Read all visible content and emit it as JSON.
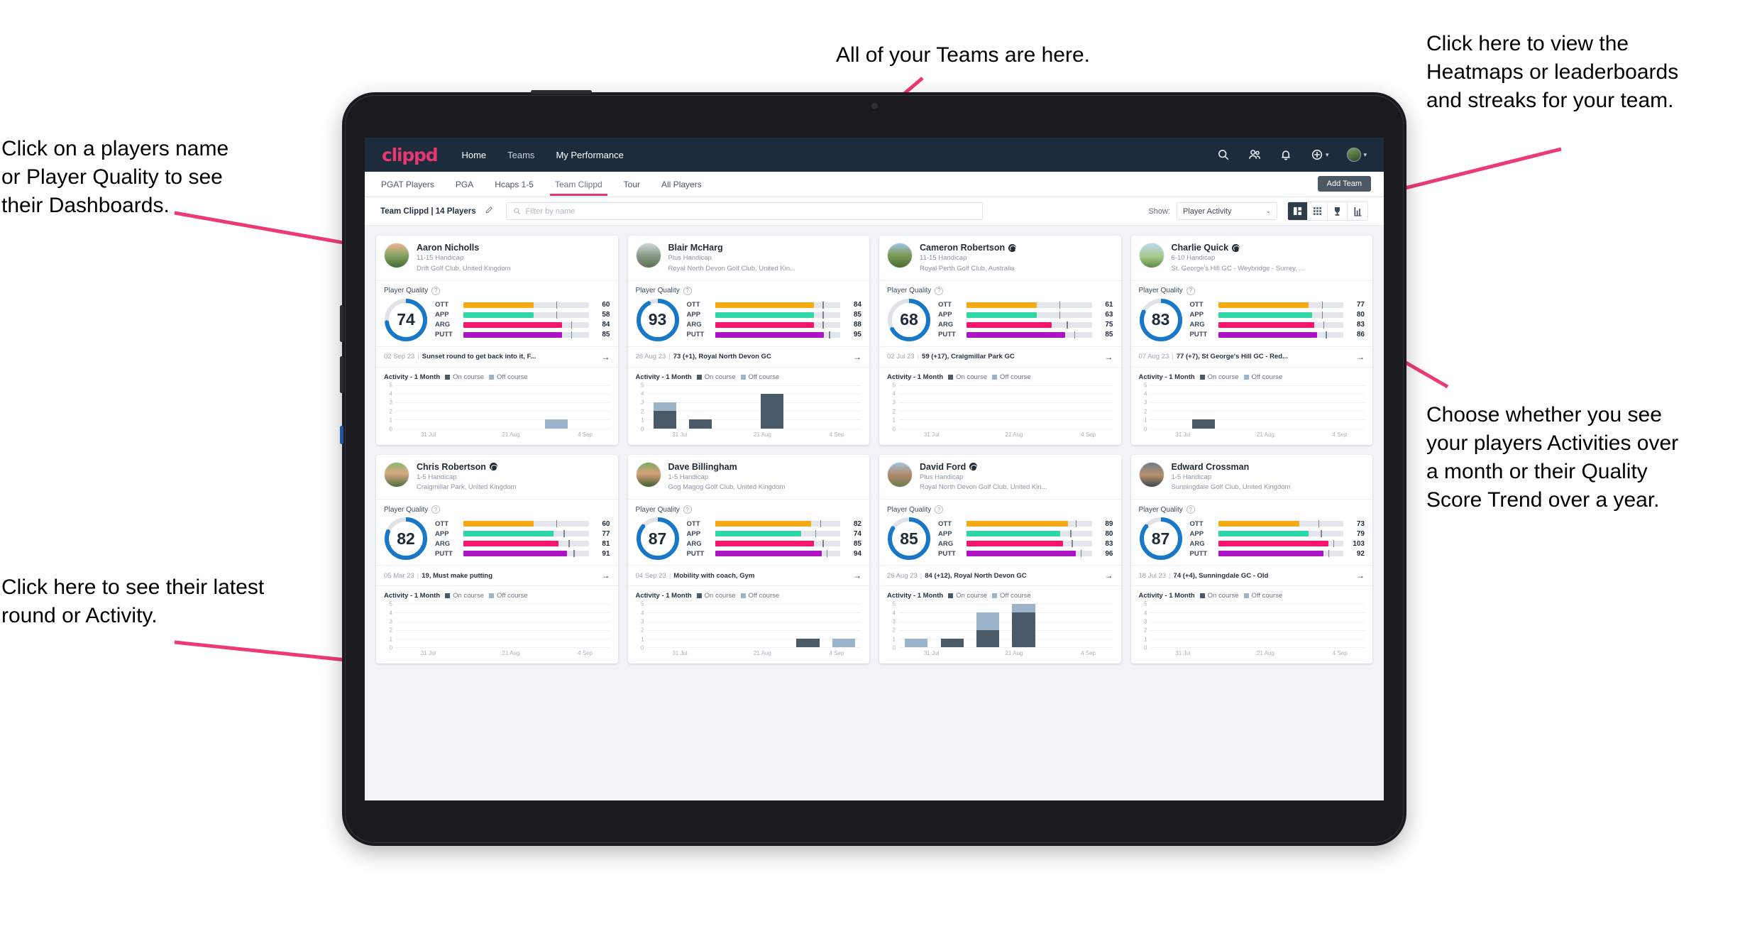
{
  "annotations": [
    {
      "id": "players-name",
      "text": "Click on a players name\nor Player Quality to see\ntheir Dashboards."
    },
    {
      "id": "teams",
      "text": "All of your Teams are here."
    },
    {
      "id": "heatmaps",
      "text": "Click here to view the\nHeatmaps or leaderboards\nand streaks for your team."
    },
    {
      "id": "activity-toggle",
      "text": "Choose whether you see\nyour players Activities over\na month or their Quality\nScore Trend over a year."
    },
    {
      "id": "latest-round",
      "text": "Click here to see their latest\nround or Activity."
    }
  ],
  "colors": {
    "accent": "#e8366f",
    "navy": "#1d2c3c",
    "ring": "#1878c8",
    "ott": "#f5ab14",
    "app": "#2fd6a8",
    "arg": "#f5156c",
    "putt": "#ab13c5",
    "on_course": "#4a5a69",
    "off_course": "#9cb4ca"
  },
  "topnav": {
    "brand": "clippd",
    "links": [
      {
        "label": "Home",
        "active": true
      },
      {
        "label": "Teams",
        "active": false
      },
      {
        "label": "My Performance",
        "active": false
      }
    ],
    "icons": [
      "search-icon",
      "people-icon",
      "bell-icon",
      "plus-circle-icon",
      "avatar"
    ]
  },
  "subnav": {
    "tabs": [
      {
        "label": "PGAT Players",
        "active": false
      },
      {
        "label": "PGA",
        "active": false
      },
      {
        "label": "Hcaps 1-5",
        "active": false
      },
      {
        "label": "Team Clippd",
        "active": true
      },
      {
        "label": "Tour",
        "active": false
      },
      {
        "label": "All Players",
        "active": false
      }
    ],
    "add_team_label": "Add Team"
  },
  "toolbar": {
    "team_label": "Team Clippd | 14 Players",
    "edit_icon": "pencil-icon",
    "search_placeholder": "Filter by name",
    "show_label": "Show:",
    "show_value": "Player Activity",
    "view_buttons": [
      "grid-large-icon",
      "grid-small-icon",
      "trophy-icon",
      "streak-icon"
    ],
    "selected_view": 0
  },
  "section_labels": {
    "player_quality": "Player Quality",
    "activity": "Activity - 1 Month",
    "legend_on": "On course",
    "legend_off": "Off course",
    "metrics": [
      "OTT",
      "APP",
      "ARG",
      "PUTT"
    ],
    "x_ticks": [
      "31 Jul",
      "21 Aug",
      "4 Sep"
    ],
    "y_ticks": [
      "5",
      "4",
      "3",
      "2",
      "1",
      "0"
    ]
  },
  "players": [
    {
      "name": "Aaron Nicholls",
      "verified": false,
      "handicap": "11-15 Handicap",
      "club": "Drift Golf Club, United Kingdom",
      "quality": 74,
      "metrics": [
        {
          "key": "OTT",
          "value": 60,
          "fill": 56,
          "tick": 74
        },
        {
          "key": "APP",
          "value": 58,
          "fill": 56,
          "tick": 74
        },
        {
          "key": "ARG",
          "value": 84,
          "fill": 79,
          "tick": 86
        },
        {
          "key": "PUTT",
          "value": 85,
          "fill": 79,
          "tick": 86
        }
      ],
      "round_date": "02 Sep 23",
      "round_text": "Sunset round to get back into it, F...",
      "chart": {
        "on": [
          0,
          0,
          0,
          0,
          0,
          0
        ],
        "off": [
          0,
          0,
          0,
          0,
          1,
          0
        ]
      }
    },
    {
      "name": "Blair McHarg",
      "verified": false,
      "handicap": "Plus Handicap",
      "club": "Royal North Devon Golf Club, United Kin...",
      "quality": 93,
      "metrics": [
        {
          "key": "OTT",
          "value": 84,
          "fill": 79,
          "tick": 86
        },
        {
          "key": "APP",
          "value": 85,
          "fill": 79,
          "tick": 86
        },
        {
          "key": "ARG",
          "value": 88,
          "fill": 79,
          "tick": 86
        },
        {
          "key": "PUTT",
          "value": 95,
          "fill": 87,
          "tick": 91
        }
      ],
      "round_date": "26 Aug 23",
      "round_text": "73 (+1), Royal North Devon GC",
      "chart": {
        "on": [
          2,
          1,
          0,
          4,
          0,
          0
        ],
        "off": [
          1,
          0,
          0,
          0,
          0,
          0
        ]
      }
    },
    {
      "name": "Cameron Robertson",
      "verified": true,
      "handicap": "11-15 Handicap",
      "club": "Royal Perth Golf Club, Australia",
      "quality": 68,
      "metrics": [
        {
          "key": "OTT",
          "value": 61,
          "fill": 56,
          "tick": 74
        },
        {
          "key": "APP",
          "value": 63,
          "fill": 56,
          "tick": 74
        },
        {
          "key": "ARG",
          "value": 75,
          "fill": 68,
          "tick": 80
        },
        {
          "key": "PUTT",
          "value": 85,
          "fill": 79,
          "tick": 86
        }
      ],
      "round_date": "02 Jul 23",
      "round_text": "59 (+17), Craigmillar Park GC",
      "chart": {
        "on": [
          0,
          0,
          0,
          0,
          0,
          0
        ],
        "off": [
          0,
          0,
          0,
          0,
          0,
          0
        ]
      }
    },
    {
      "name": "Charlie Quick",
      "verified": true,
      "handicap": "6-10 Handicap",
      "club": "St. George's Hill GC - Weybridge - Surrey, ...",
      "quality": 83,
      "metrics": [
        {
          "key": "OTT",
          "value": 77,
          "fill": 72,
          "tick": 83
        },
        {
          "key": "APP",
          "value": 80,
          "fill": 75,
          "tick": 83
        },
        {
          "key": "ARG",
          "value": 83,
          "fill": 77,
          "tick": 84
        },
        {
          "key": "PUTT",
          "value": 86,
          "fill": 79,
          "tick": 86
        }
      ],
      "round_date": "07 Aug 23",
      "round_text": "77 (+7), St George's Hill GC - Red...",
      "chart": {
        "on": [
          0,
          1,
          0,
          0,
          0,
          0
        ],
        "off": [
          0,
          0,
          0,
          0,
          0,
          0
        ]
      }
    },
    {
      "name": "Chris Robertson",
      "verified": true,
      "handicap": "1-5 Handicap",
      "club": "Craigmillar Park, United Kingdom",
      "quality": 82,
      "metrics": [
        {
          "key": "OTT",
          "value": 60,
          "fill": 56,
          "tick": 74
        },
        {
          "key": "APP",
          "value": 77,
          "fill": 72,
          "tick": 80
        },
        {
          "key": "ARG",
          "value": 81,
          "fill": 76,
          "tick": 84
        },
        {
          "key": "PUTT",
          "value": 91,
          "fill": 83,
          "tick": 88
        }
      ],
      "round_date": "05 Mar 23",
      "round_text": "19, Must make putting",
      "chart": {
        "on": [
          0,
          0,
          0,
          0,
          0,
          0
        ],
        "off": [
          0,
          0,
          0,
          0,
          0,
          0
        ]
      }
    },
    {
      "name": "Dave Billingham",
      "verified": false,
      "handicap": "1-5 Handicap",
      "club": "Gog Magog Golf Club, United Kingdom",
      "quality": 87,
      "metrics": [
        {
          "key": "OTT",
          "value": 82,
          "fill": 77,
          "tick": 84
        },
        {
          "key": "APP",
          "value": 74,
          "fill": 69,
          "tick": 80
        },
        {
          "key": "ARG",
          "value": 85,
          "fill": 79,
          "tick": 86
        },
        {
          "key": "PUTT",
          "value": 94,
          "fill": 85,
          "tick": 89
        }
      ],
      "round_date": "04 Sep 23",
      "round_text": "Mobility with coach, Gym",
      "chart": {
        "on": [
          0,
          0,
          0,
          0,
          1,
          0
        ],
        "off": [
          0,
          0,
          0,
          0,
          0,
          1
        ]
      }
    },
    {
      "name": "David Ford",
      "verified": true,
      "handicap": "Plus Handicap",
      "club": "Royal North Devon Golf Club, United Kin...",
      "quality": 85,
      "metrics": [
        {
          "key": "OTT",
          "value": 89,
          "fill": 81,
          "tick": 87
        },
        {
          "key": "APP",
          "value": 80,
          "fill": 75,
          "tick": 83
        },
        {
          "key": "ARG",
          "value": 83,
          "fill": 77,
          "tick": 84
        },
        {
          "key": "PUTT",
          "value": 96,
          "fill": 87,
          "tick": 91
        }
      ],
      "round_date": "26 Aug 23",
      "round_text": "84 (+12), Royal North Devon GC",
      "chart": {
        "on": [
          0,
          1,
          2,
          4,
          0,
          0
        ],
        "off": [
          1,
          0,
          2,
          1,
          0,
          0
        ]
      }
    },
    {
      "name": "Edward Crossman",
      "verified": false,
      "handicap": "1-5 Handicap",
      "club": "Sunningdale Golf Club, United Kingdom",
      "quality": 87,
      "metrics": [
        {
          "key": "OTT",
          "value": 73,
          "fill": 65,
          "tick": 80
        },
        {
          "key": "APP",
          "value": 79,
          "fill": 72,
          "tick": 82
        },
        {
          "key": "ARG",
          "value": 103,
          "fill": 88,
          "tick": 92
        },
        {
          "key": "PUTT",
          "value": 92,
          "fill": 84,
          "tick": 88
        }
      ],
      "round_date": "18 Jul 23",
      "round_text": "74 (+4), Sunningdale GC - Old",
      "chart": {
        "on": [
          0,
          0,
          0,
          0,
          0,
          0
        ],
        "off": [
          0,
          0,
          0,
          0,
          0,
          0
        ]
      }
    }
  ]
}
